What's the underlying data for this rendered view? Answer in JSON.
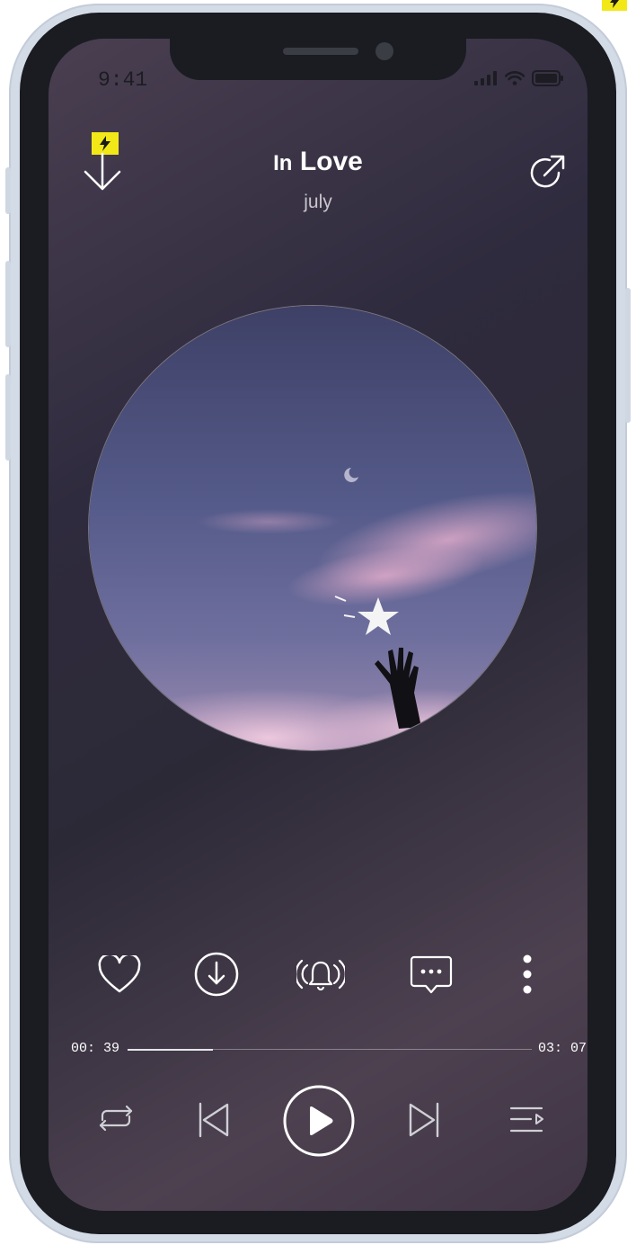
{
  "status_bar": {
    "time": "9:41"
  },
  "header": {
    "title_prefix": "In",
    "title_main": "Love",
    "artist": "july"
  },
  "actions": {
    "like_icon": "heart-icon",
    "download_icon": "download-circle-icon",
    "ringtone_icon": "ringtone-bell-icon",
    "comment_icon": "comment-icon",
    "more_icon": "more-vertical-icon"
  },
  "progress": {
    "current_time": "00: 39",
    "total_time": "03: 07",
    "played_fraction": 0.21
  },
  "controls": {
    "repeat_icon": "repeat-icon",
    "previous_icon": "previous-track-icon",
    "play_icon": "play-icon",
    "next_icon": "next-track-icon",
    "playlist_icon": "playlist-icon"
  },
  "colors": {
    "badge": "#f3e817",
    "text_primary": "#ffffff",
    "text_secondary": "#c9c5cc"
  }
}
